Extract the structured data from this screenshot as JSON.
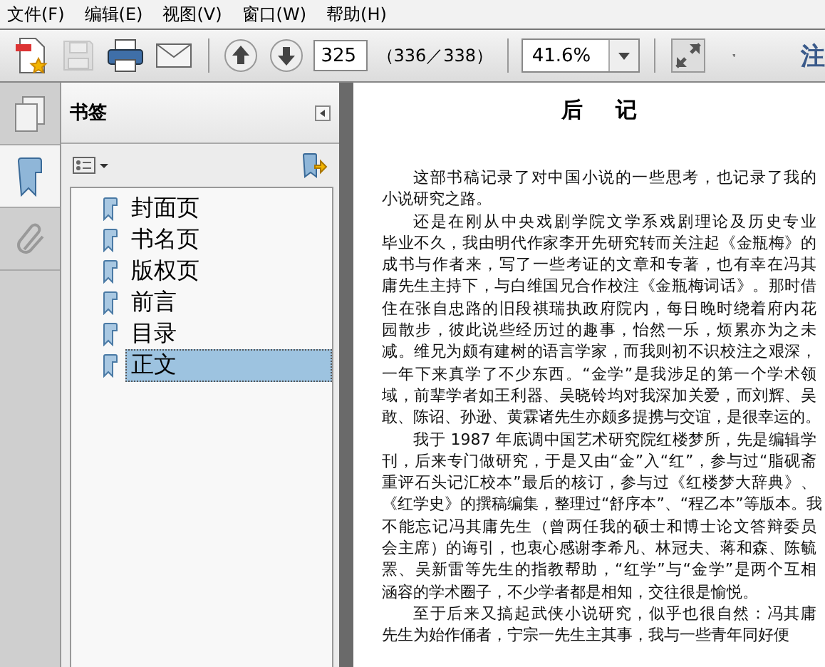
{
  "menu": [
    {
      "label": "文件(F)"
    },
    {
      "label": "编辑(E)"
    },
    {
      "label": "视图(V)"
    },
    {
      "label": "窗口(W)"
    },
    {
      "label": "帮助(H)"
    }
  ],
  "toolbar": {
    "file_buttons": [
      {
        "kind": "create",
        "disabled": false
      },
      {
        "kind": "save",
        "disabled": true
      },
      {
        "kind": "print",
        "disabled": false
      },
      {
        "kind": "email",
        "disabled": false
      }
    ],
    "nav_buttons": [
      {
        "kind": "up",
        "disabled": false
      },
      {
        "kind": "down",
        "disabled": false
      }
    ],
    "page_field": {
      "value": "325"
    },
    "page_count": "（336／338）",
    "zoom_field": {
      "value": "41.6%"
    },
    "comments_label": "注"
  },
  "sidebar": {
    "tabs": [
      {
        "kind": "pages",
        "selected": false
      },
      {
        "kind": "bookmarks",
        "selected": true
      },
      {
        "kind": "attachments",
        "selected": false
      }
    ],
    "panel_title": "书签",
    "bookmarks": [
      {
        "label": "封面页",
        "selected": false
      },
      {
        "label": "书名页",
        "selected": false
      },
      {
        "label": "版权页",
        "selected": false
      },
      {
        "label": "前言",
        "selected": false
      },
      {
        "label": "目录",
        "selected": false
      },
      {
        "label": "正文",
        "selected": true
      }
    ]
  },
  "document": {
    "title": "后 记",
    "paragraphs": [
      {
        "lines": [
          "这部书稿记录了对中国小说的一些思考，也记录了我的",
          "小说研究之路。"
        ]
      },
      {
        "lines": [
          "还是在刚从中央戏剧学院文学系戏剧理论及历史专业",
          "毕业不久，我由明代作家李开先研究转而关注起《金瓶梅》的",
          "成书与作者来，写了一些考证的文章和专著，也有幸在冯其",
          "庸先生主持下，与白维国兄合作校注《金瓶梅词话》。那时借",
          "住在张自忠路的旧段祺瑞执政府院内，每日晚时绕着府内花",
          "园散步，彼此说些经历过的趣事，怡然一乐，烦累亦为之未",
          "减。维兄为颇有建树的语言学家，而我则初不识校注之艰深，",
          "一年下来真学了不少东西。“金学”是我涉足的第一个学术领",
          "域，前辈学者如王利器、吴晓铃均对我深加关爱，而刘辉、吴",
          "敢、陈诏、孙逊、黄霖诸先生亦颇多提携与交谊，是很幸运的。"
        ]
      },
      {
        "lines": [
          "我于 1987 年底调中国艺术研究院红楼梦所，先是编辑学",
          "刊，后来专门做研究，于是又由“金”入“红”，参与过“脂砚斋",
          "重评石头记汇校本”最后的核订，参与过《红楼梦大辞典》、",
          "《红学史》的撰稿编集，整理过“舒序本”、“程乙本”等版本。我",
          "不能忘记冯其庸先生（曾两任我的硕士和博士论文答辩委员",
          "会主席）的诲引，也衷心感谢李希凡、林冠夫、蒋和森、陈毓",
          "罴、吴新雷等先生的指教帮助，“红学”与“金学”是两个互相",
          "涵容的学术圈子，不少学者都是相知，交往很是愉悦。"
        ]
      },
      {
        "lines": [
          "至于后来又搞起武侠小说研究，似乎也很自然：冯其庸",
          "先生为始作俑者，宁宗一先生主其事，我与一些青年同好便"
        ]
      }
    ]
  }
}
